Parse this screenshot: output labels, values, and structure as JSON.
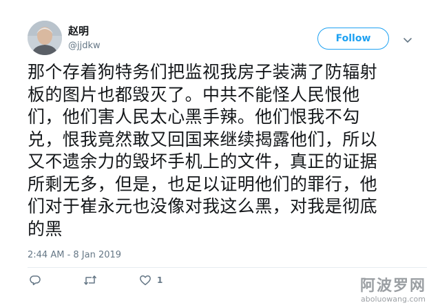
{
  "user": {
    "display_name": "赵明",
    "handle": "@jjdkw"
  },
  "follow_label": "Follow",
  "tweet": {
    "lines": [
      "那个存着狗特务们把监视我房子装满了防辐射",
      "板的图片也都毁灭了。中共不能怪人民恨他",
      "们，他们害人民太心黑手辣。他们恨我不勾",
      "兑，恨我竟然敢又回国来继续揭露他们，所以",
      "又不遗余力的毁坏手机上的文件，真正的证据",
      "所剩无多，但是，也足以证明他们的罪行，他",
      "们对于崔永元也没像对我这么黑，对我是彻底",
      "的黑"
    ],
    "timestamp": "2:44 AM - 8 Jan 2019"
  },
  "actions": {
    "like_count": "1"
  },
  "icons": {
    "more": "chevron-down-icon",
    "reply": "reply-icon",
    "retweet": "retweet-icon",
    "like": "heart-icon"
  },
  "watermark": {
    "title": "阿波罗网",
    "url": "aboluowang.com"
  },
  "colors": {
    "accent": "#1da1f2",
    "secondary_text": "#657786"
  }
}
